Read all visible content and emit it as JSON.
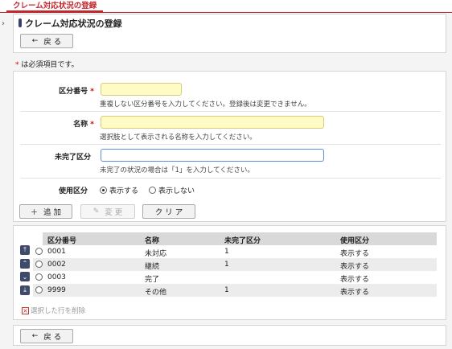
{
  "tab": {
    "label": "クレーム対応状況の登録"
  },
  "header": {
    "title": "クレーム対応状況の登録",
    "back_label": "戻 る"
  },
  "required_note": {
    "mark": "*",
    "text": " は必須項目です。"
  },
  "form": {
    "code": {
      "label": "区分番号",
      "required_mark": "*",
      "value": "",
      "hint": "重複しない区分番号を入力してください。登録後は変更できません。"
    },
    "name": {
      "label": "名称",
      "required_mark": "*",
      "value": "",
      "hint": "選択肢として表示される名称を入力してください。"
    },
    "incomplete": {
      "label": "未完了区分",
      "value": "",
      "hint": "未完了の状況の場合は「1」を入力してください。"
    },
    "usage": {
      "label": "使用区分",
      "options": [
        "表示する",
        "表示しない"
      ],
      "selected": "表示する"
    }
  },
  "actions": {
    "add": "追 加",
    "edit": "変 更",
    "clear": "ク リ ア"
  },
  "table": {
    "columns": [
      "区分番号",
      "名称",
      "未完了区分",
      "使用区分"
    ],
    "rows": [
      [
        "0001",
        "未対応",
        "1",
        "表示する"
      ],
      [
        "0002",
        "継続",
        "1",
        "表示する"
      ],
      [
        "0003",
        "完了",
        "",
        "表示する"
      ],
      [
        "9999",
        "その他",
        "1",
        "表示する"
      ]
    ],
    "delete_label": "選択した行を削除"
  },
  "footer": {
    "back_label": "戻 る"
  },
  "icons": {
    "back": "arrow-left-icon",
    "add": "plus-icon",
    "edit": "pencil-icon",
    "top": "move-top-icon",
    "up": "move-up-icon",
    "down": "move-down-icon",
    "bottom": "move-bottom-icon",
    "delete": "delete-x-icon"
  },
  "colors": {
    "accent": "#c0282e",
    "required_field": "#fffbc4",
    "move_button": "#3f4a6b"
  }
}
